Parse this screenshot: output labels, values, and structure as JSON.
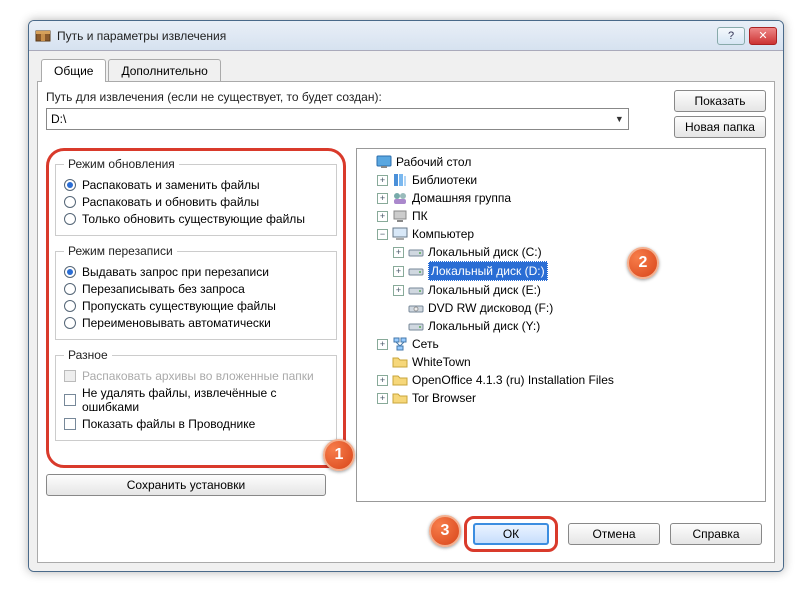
{
  "window": {
    "title": "Путь и параметры извлечения",
    "help_icon": "help-icon",
    "close_icon": "close-icon"
  },
  "tabs": {
    "general": "Общие",
    "advanced": "Дополнительно"
  },
  "path": {
    "label": "Путь для извлечения (если не существует, то будет создан):",
    "value": "D:\\"
  },
  "buttons": {
    "show": "Показать",
    "new_folder": "Новая папка",
    "save_settings": "Сохранить установки",
    "ok": "ОК",
    "cancel": "Отмена",
    "help": "Справка"
  },
  "groups": {
    "update_mode": {
      "legend": "Режим обновления",
      "opt1": "Распаковать и заменить файлы",
      "opt2": "Распаковать и обновить файлы",
      "opt3": "Только обновить существующие файлы"
    },
    "overwrite_mode": {
      "legend": "Режим перезаписи",
      "opt1": "Выдавать запрос при перезаписи",
      "opt2": "Перезаписывать без запроса",
      "opt3": "Пропускать существующие файлы",
      "opt4": "Переименовывать автоматически"
    },
    "misc": {
      "legend": "Разное",
      "chk1": "Распаковать архивы во вложенные папки",
      "chk2": "Не удалять файлы, извлечённые с ошибками",
      "chk3": "Показать файлы в Проводнике"
    }
  },
  "tree": {
    "desktop": "Рабочий стол",
    "libraries": "Библиотеки",
    "homegroup": "Домашняя группа",
    "pc": "ПК",
    "computer": "Компьютер",
    "disk_c": "Локальный диск (C:)",
    "disk_d": "Локальный диск (D:)",
    "disk_e": "Локальный диск (E:)",
    "dvd": "DVD RW дисковод (F:)",
    "disk_y": "Локальный диск (Y:)",
    "network": "Сеть",
    "whitetown": "WhiteTown",
    "openoffice": "OpenOffice 4.1.3 (ru) Installation Files",
    "tor": "Tor Browser"
  },
  "badges": {
    "b1": "1",
    "b2": "2",
    "b3": "3"
  }
}
